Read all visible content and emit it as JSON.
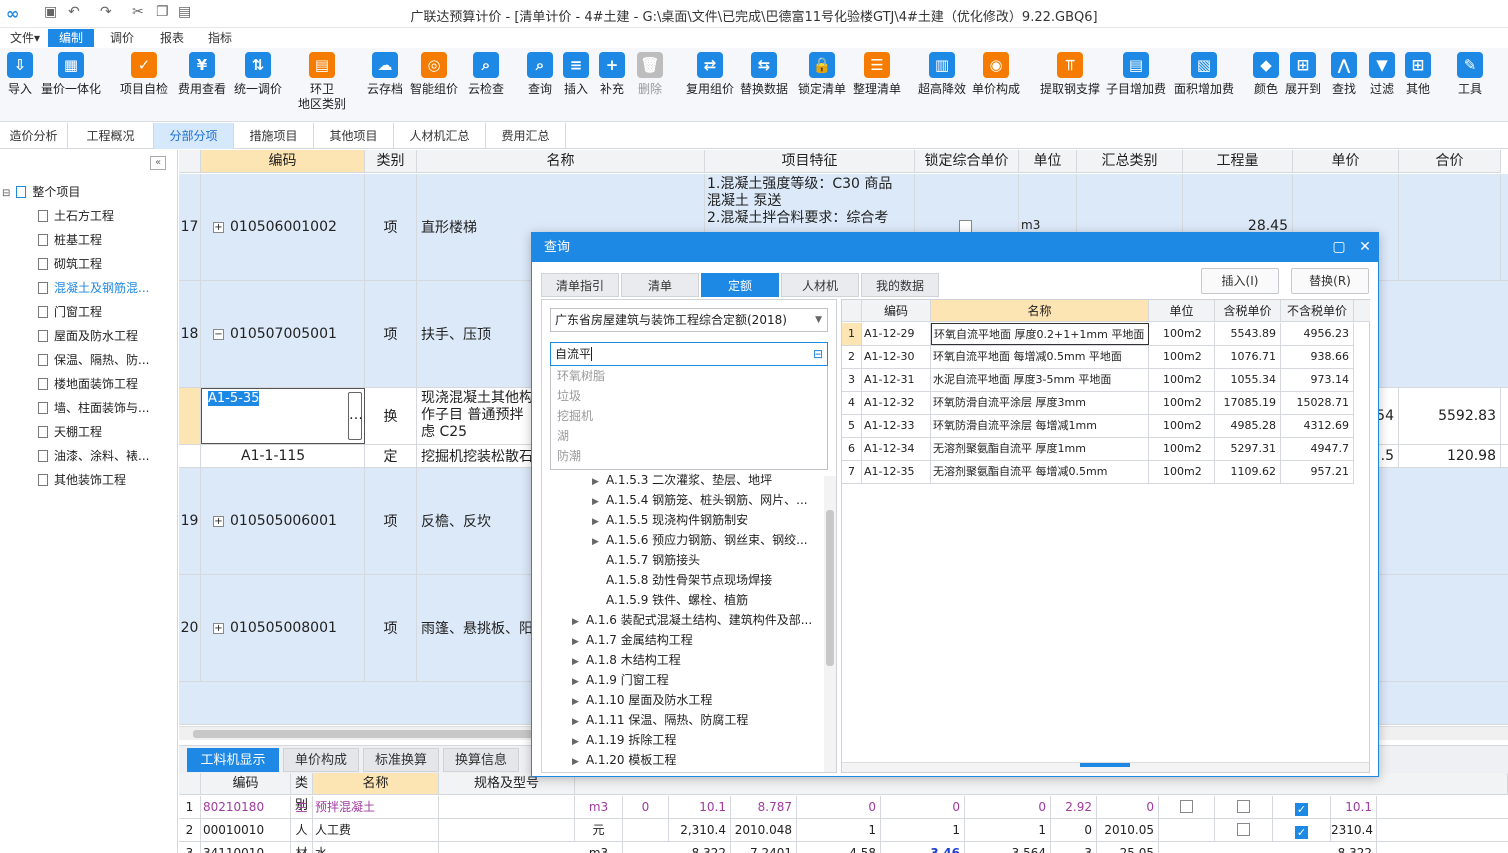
{
  "window": {
    "title": "广联达预算计价 - [清单计价 - 4#土建 - G:\\桌面\\文件\\已完成\\巴德富11号化验楼GTJ\\4#土建（优化修改）9.22.GBQ6]"
  },
  "menu": [
    "文件▾",
    "编制",
    "调价",
    "报表",
    "指标"
  ],
  "ribbon": [
    {
      "label": "导入",
      "icon": "import-icon"
    },
    {
      "label": "量价一体化",
      "icon": "integration-icon"
    },
    {
      "label": "项目自检",
      "icon": "self-check-icon"
    },
    {
      "label": "费用查看",
      "icon": "fee-view-icon"
    },
    {
      "label": "统一调价",
      "icon": "unified-price-icon"
    },
    {
      "label": "环卫",
      "label2": "地区类别",
      "icon": "region-icon"
    },
    {
      "label": "云存档",
      "icon": "cloud-archive-icon"
    },
    {
      "label": "智能组价",
      "icon": "smart-pricing-icon"
    },
    {
      "label": "云检查",
      "icon": "cloud-check-icon"
    },
    {
      "label": "查询",
      "icon": "query-icon"
    },
    {
      "label": "插入",
      "icon": "insert-icon"
    },
    {
      "label": "补充",
      "icon": "supplement-icon"
    },
    {
      "label": "删除",
      "icon": "delete-icon"
    },
    {
      "label": "复用组价",
      "icon": "reuse-pricing-icon"
    },
    {
      "label": "替换数据",
      "icon": "replace-data-icon"
    },
    {
      "label": "锁定清单",
      "icon": "lock-list-icon"
    },
    {
      "label": "整理清单",
      "icon": "organize-list-icon"
    },
    {
      "label": "超高降效",
      "icon": "height-reduce-icon"
    },
    {
      "label": "单价构成",
      "icon": "unit-price-icon"
    },
    {
      "label": "提取钢支撑",
      "icon": "steel-support-icon"
    },
    {
      "label": "子目增加费",
      "icon": "subitem-fee-icon"
    },
    {
      "label": "面积增加费",
      "icon": "area-fee-icon"
    },
    {
      "label": "颜色",
      "icon": "color-icon"
    },
    {
      "label": "展开到",
      "icon": "expand-icon"
    },
    {
      "label": "查找",
      "icon": "find-icon"
    },
    {
      "label": "过滤",
      "icon": "filter-icon"
    },
    {
      "label": "其他",
      "icon": "other-icon"
    },
    {
      "label": "工具",
      "icon": "tools-icon"
    }
  ],
  "tabs": [
    "造价分析",
    "工程概况",
    "分部分项",
    "措施项目",
    "其他项目",
    "人材机汇总",
    "费用汇总"
  ],
  "tree": {
    "root": "整个项目",
    "items": [
      "土石方工程",
      "桩基工程",
      "砌筑工程",
      "混凝土及钢筋混...",
      "门窗工程",
      "屋面及防水工程",
      "保温、隔热、防...",
      "楼地面装饰工程",
      "墙、柱面装饰与...",
      "天棚工程",
      "油漆、涂料、裱...",
      "其他装饰工程"
    ]
  },
  "grid": {
    "headers": [
      "编码",
      "类别",
      "名称",
      "项目特征",
      "锁定综合单价",
      "单位",
      "汇总类别",
      "工程量",
      "单价",
      "合价"
    ],
    "rows": [
      {
        "no": "17",
        "code": "010506001002",
        "type": "项",
        "name": "直形楼梯",
        "feature": "1.混凝土强度等级：C30 商品\n混凝土 泵送\n2.混凝土拌合料要求：综合考",
        "unit": "m3",
        "qty": "28.45",
        "price": "",
        "total": ""
      },
      {
        "no": "18",
        "code": "010507005001",
        "type": "项",
        "name": "扶手、压顶",
        "feature": "",
        "unit": "",
        "qty": "",
        "price": "",
        "total": ""
      },
      {
        "no": "",
        "code": "A1-5-35",
        "type": "换",
        "name": "现浇混凝土其他构\n作子目 普通预拌\n虑 C25",
        "feature": "",
        "unit": "",
        "qty": "",
        "price": "54",
        "total": "5592.83"
      },
      {
        "no": "",
        "code": "A1-1-115",
        "type": "定",
        "name": "挖掘机挖装松散石",
        "feature": "",
        "unit": "",
        "qty": "",
        "price": ".5",
        "total": "120.98"
      },
      {
        "no": "19",
        "code": "010505006001",
        "type": "项",
        "name": "反檐、反坎",
        "feature": "",
        "unit": "",
        "qty": "",
        "price": "",
        "total": ""
      },
      {
        "no": "20",
        "code": "010505008001",
        "type": "项",
        "name": "雨篷、悬挑板、阳",
        "feature": "",
        "unit": "",
        "qty": "",
        "price": "",
        "total": ""
      }
    ]
  },
  "bottom_tabs": [
    "工料机显示",
    "单价构成",
    "标准换算",
    "换算信息"
  ],
  "bottom_grid": {
    "headers": [
      "编码",
      "类别",
      "名称",
      "规格及型号"
    ],
    "rows": [
      {
        "no": "1",
        "code": "80210180",
        "type": "主",
        "name": "预拌混凝土",
        "unit": "m3",
        "v1": "0",
        "v2": "10.1",
        "v3": "8.787",
        "v4": "0",
        "v5": "0",
        "v6": "0",
        "v7": "2.92",
        "v8": "0",
        "last": "10.1"
      },
      {
        "no": "2",
        "code": "00010010",
        "type": "人",
        "name": "人工费",
        "unit": "元",
        "v1": "",
        "v2": "2,310.4",
        "v3": "2010.048",
        "v4": "1",
        "v5": "1",
        "v6": "1",
        "v7": "0",
        "v8": "2010.05",
        "last": "2310.4"
      },
      {
        "no": "3",
        "code": "34110010",
        "type": "材",
        "name": "水",
        "unit": "m3",
        "v1": "",
        "v2": "8.322",
        "v3": "7.2401",
        "v4": "4.58",
        "v5": "3.46",
        "v6": "3.564",
        "v7": "3",
        "v8": "25.05",
        "last": "8.322"
      }
    ]
  },
  "dialog": {
    "title": "查询",
    "tabs": [
      "清单指引",
      "清单",
      "定额",
      "人材机",
      "我的数据"
    ],
    "insert_btn": "插入(I)",
    "replace_btn": "替换(R)",
    "quota_library": "广东省房屋建筑与装饰工程综合定额(2018)",
    "search_value": "自流平",
    "suggestions": [
      "环氧树脂",
      "垃圾",
      "挖掘机",
      "湖",
      "防潮"
    ],
    "tree_items": [
      {
        "label": "A.1.5.3 二次灌浆、垫层、地坪",
        "level": 2,
        "arrow": true
      },
      {
        "label": "A.1.5.4 钢筋笼、桩头钢筋、网片、...",
        "level": 2,
        "arrow": true
      },
      {
        "label": "A.1.5.5 现浇构件钢筋制安",
        "level": 2,
        "arrow": true
      },
      {
        "label": "A.1.5.6 预应力钢筋、钢丝束、钢绞...",
        "level": 2,
        "arrow": true
      },
      {
        "label": "A.1.5.7 钢筋接头",
        "level": 3,
        "arrow": false
      },
      {
        "label": "A.1.5.8 劲性骨架节点现场焊接",
        "level": 3,
        "arrow": false
      },
      {
        "label": "A.1.5.9 铁件、螺栓、植筋",
        "level": 3,
        "arrow": false
      },
      {
        "label": "A.1.6 装配式混凝土结构、建筑构件及部...",
        "level": 1,
        "arrow": true
      },
      {
        "label": "A.1.7 金属结构工程",
        "level": 1,
        "arrow": true
      },
      {
        "label": "A.1.8 木结构工程",
        "level": 1,
        "arrow": true
      },
      {
        "label": "A.1.9 门窗工程",
        "level": 1,
        "arrow": true
      },
      {
        "label": "A.1.10 屋面及防水工程",
        "level": 1,
        "arrow": true
      },
      {
        "label": "A.1.11 保温、隔热、防腐工程",
        "level": 1,
        "arrow": true
      },
      {
        "label": "A.1.19 拆除工程",
        "level": 1,
        "arrow": true
      },
      {
        "label": "A.1.20 模板工程",
        "level": 1,
        "arrow": true
      }
    ],
    "result_headers": [
      "编码",
      "名称",
      "单位",
      "含税单价",
      "不含税单价"
    ],
    "results": [
      {
        "no": "1",
        "code": "A1-12-29",
        "name": "环氧自流平地面 厚度0.2+1+1mm 平地面",
        "unit": "100m2",
        "tax": "5543.89",
        "notax": "4956.23"
      },
      {
        "no": "2",
        "code": "A1-12-30",
        "name": "环氧自流平地面 每增减0.5mm 平地面",
        "unit": "100m2",
        "tax": "1076.71",
        "notax": "938.66"
      },
      {
        "no": "3",
        "code": "A1-12-31",
        "name": "水泥自流平地面 厚度3-5mm 平地面",
        "unit": "100m2",
        "tax": "1055.34",
        "notax": "973.14"
      },
      {
        "no": "4",
        "code": "A1-12-32",
        "name": "环氧防滑自流平涂层 厚度3mm",
        "unit": "100m2",
        "tax": "17085.19",
        "notax": "15028.71"
      },
      {
        "no": "5",
        "code": "A1-12-33",
        "name": "环氧防滑自流平涂层 每增减1mm",
        "unit": "100m2",
        "tax": "4985.28",
        "notax": "4312.69"
      },
      {
        "no": "6",
        "code": "A1-12-34",
        "name": "无溶剂聚氨酯自流平 厚度1mm",
        "unit": "100m2",
        "tax": "5297.31",
        "notax": "4947.7"
      },
      {
        "no": "7",
        "code": "A1-12-35",
        "name": "无溶剂聚氨酯自流平 每增减0.5mm",
        "unit": "100m2",
        "tax": "1109.62",
        "notax": "957.21"
      }
    ]
  }
}
